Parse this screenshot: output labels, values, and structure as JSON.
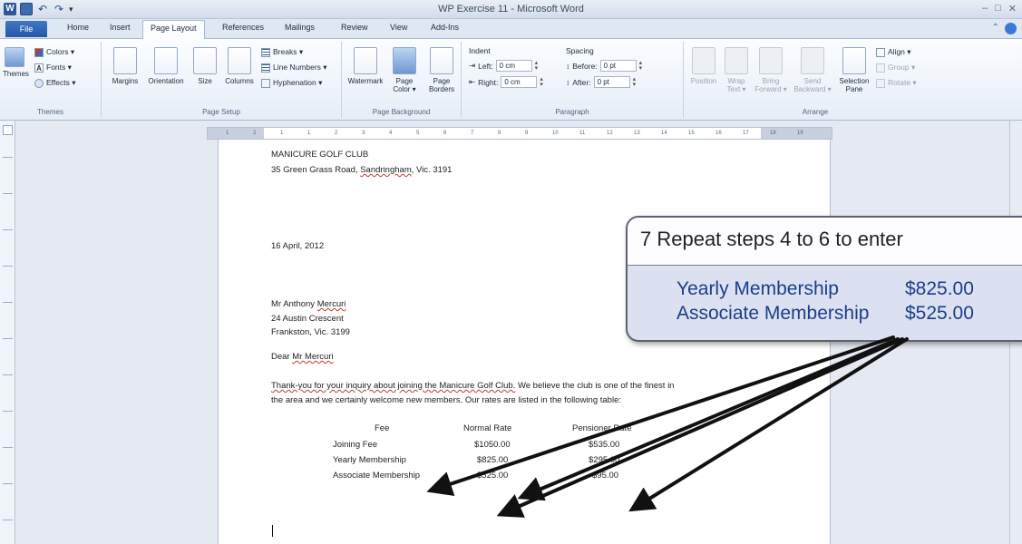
{
  "window": {
    "title": "WP Exercise 11 - Microsoft Word",
    "buttons": [
      "–",
      "□",
      "✕"
    ]
  },
  "tabs": [
    {
      "label": "File"
    },
    {
      "label": "Home"
    },
    {
      "label": "Insert"
    },
    {
      "label": "Page Layout"
    },
    {
      "label": "References"
    },
    {
      "label": "Mailings"
    },
    {
      "label": "Review"
    },
    {
      "label": "View"
    },
    {
      "label": "Add-Ins"
    }
  ],
  "ribbon": {
    "themes": {
      "themes_label": "Themes",
      "colors": "Colors ▾",
      "fonts": "Fonts ▾",
      "effects": "Effects ▾",
      "group": "Themes"
    },
    "page_setup": {
      "margins": "Margins",
      "orientation": "Orientation",
      "size": "Size",
      "columns": "Columns",
      "breaks": "Breaks ▾",
      "line_numbers": "Line Numbers ▾",
      "hyphenation": "Hyphenation ▾",
      "group": "Page Setup"
    },
    "page_background": {
      "watermark": "Watermark",
      "page_color": "Page Color ▾",
      "page_borders": "Page Borders",
      "group": "Page Background"
    },
    "paragraph": {
      "indent": "Indent",
      "left": "Left:",
      "left_value": "0 cm",
      "right": "Right:",
      "right_value": "0 cm",
      "spacing": "Spacing",
      "before": "Before:",
      "before_value": "0 pt",
      "after": "After:",
      "after_value": "0 pt",
      "group": "Paragraph"
    },
    "arrange": {
      "position": "Position",
      "wrap_text": "Wrap Text ▾",
      "bring_forward": "Bring Forward ▾",
      "send_backward": "Send Backward ▾",
      "selection_pane": "Selection Pane",
      "align": "Align ▾",
      "group_btn": "Group ▾",
      "rotate": "Rotate ▾",
      "group": "Arrange"
    }
  },
  "document": {
    "club_name": "MANICURE GOLF CLUB",
    "club_address_pre": "35 Green Grass Road, ",
    "club_address_town": "Sandringham",
    "club_address_post": ", Vic. 3191",
    "date": "16 April, 2012",
    "recipient_pre": "Mr Anthony ",
    "recipient_surname": "Mercuri",
    "street": "24 Austin Crescent",
    "town": "Frankston, Vic. 3199",
    "salutation_pre": "Dear ",
    "salutation_name": "Mr Mercuri",
    "body_line1_pre": "",
    "body_line1_link": "Thank-you for your inquiry about joining the Manicure Golf Club.",
    "body_line1_post": "  We believe the club is one of the finest in",
    "body_line2": "the area and we certainly welcome new members.  Our rates are listed in the following table:",
    "table": {
      "headers": [
        "Fee",
        "Normal Rate",
        "Pensioner Rate"
      ],
      "rows": [
        [
          "Joining Fee",
          "$1050.00",
          "$535.00"
        ],
        [
          "Yearly Membership",
          "$825.00",
          "$295.00"
        ],
        [
          "Associate Membership",
          "$525.00",
          "$95.00"
        ]
      ]
    }
  },
  "callout": {
    "step": "7  Repeat steps 4 to 6 to enter",
    "rows": [
      {
        "label": "Yearly Membership",
        "value": "$825.00"
      },
      {
        "label": "Associate Membership",
        "value": "$525.00"
      }
    ]
  },
  "ruler": {
    "ticks": [
      "1",
      "2",
      "1",
      "1",
      "2",
      "3",
      "4",
      "5",
      "6",
      "7",
      "8",
      "9",
      "10",
      "11",
      "12",
      "13",
      "14",
      "15",
      "16",
      "17",
      "18",
      "19"
    ]
  }
}
